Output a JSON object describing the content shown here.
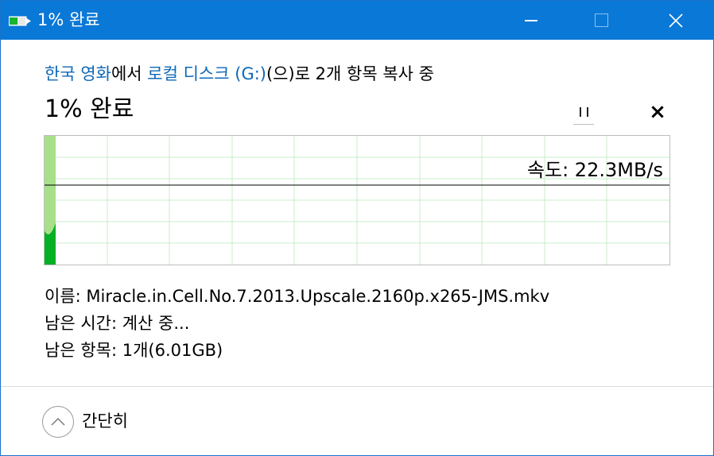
{
  "window": {
    "title": "1% 완료",
    "icon": "copy-progress-icon"
  },
  "subtitle": {
    "source": "한국 영화",
    "text1": "에서 ",
    "destination": "로컬 디스크 (G:)",
    "text2": "(으)로 2개 항목 복사 중"
  },
  "progress": {
    "heading": "1% 완료",
    "percent": 1,
    "pause_icon": "pause-icon",
    "stop_icon": "close-icon",
    "stop_label": "×"
  },
  "speed_graph": {
    "label": "속도: 22.3MB/s",
    "current_speed_mb_s": 22.3,
    "fill_color": "#06b025",
    "done_color": "#a8e08a",
    "grid_color": "#c9ecc9"
  },
  "details": {
    "name_line": "이름:  Miracle.in.Cell.No.7.2013.Upscale.2160p.x265-JMS.mkv",
    "time_line": "남은 시간:  계산 중...",
    "items_line": "남은 항목:  1개(6.01GB)"
  },
  "footer": {
    "collapse_label": "간단히",
    "collapse_icon": "chevron-up-icon"
  }
}
